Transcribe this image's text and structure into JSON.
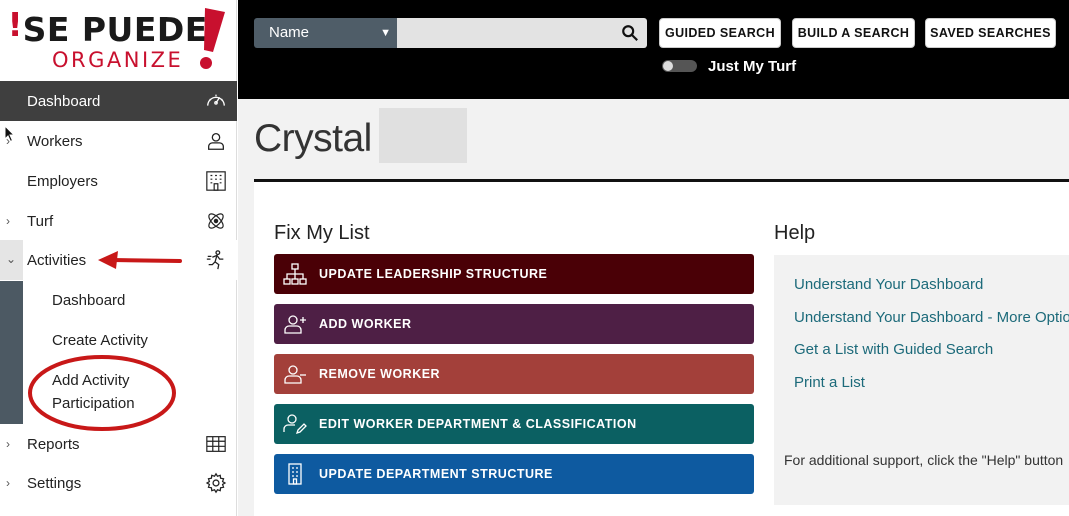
{
  "logo": {
    "line1_prefix": "¡",
    "line1_text": "SE PUEDE",
    "line2": "ORGANIZE",
    "bang": "!"
  },
  "sidebar": {
    "items": [
      {
        "label": "Dashboard",
        "icon": "speedometer-icon"
      },
      {
        "label": "Workers",
        "icon": "person-icon"
      },
      {
        "label": "Employers",
        "icon": "building-icon"
      },
      {
        "label": "Turf",
        "icon": "atom-icon"
      },
      {
        "label": "Activities",
        "icon": "activity-icon"
      },
      {
        "label": "Reports",
        "icon": "table-icon"
      },
      {
        "label": "Settings",
        "icon": "gear-icon"
      }
    ],
    "activities_sub": [
      {
        "label": "Dashboard"
      },
      {
        "label": "Create Activity"
      },
      {
        "label": "Add Activity Participation"
      }
    ]
  },
  "topbar": {
    "search_select_value": "Name",
    "search_placeholder": "",
    "buttons": [
      "GUIDED SEARCH",
      "BUILD A SEARCH",
      "SAVED SEARCHES"
    ],
    "toggle_label": "Just My Turf"
  },
  "main": {
    "title": "Crystal",
    "fix_heading": "Fix My List",
    "fix_buttons": [
      {
        "label": "UPDATE LEADERSHIP STRUCTURE",
        "color": "#4a0006",
        "icon": "org-chart-icon"
      },
      {
        "label": "ADD WORKER",
        "color": "#4e1f45",
        "icon": "add-user-icon"
      },
      {
        "label": "REMOVE WORKER",
        "color": "#a3403a",
        "icon": "remove-user-icon"
      },
      {
        "label": "EDIT WORKER DEPARTMENT & CLASSIFICATION",
        "color": "#0b6062",
        "icon": "edit-user-icon"
      },
      {
        "label": "UPDATE DEPARTMENT STRUCTURE",
        "color": "#0e5aa0",
        "icon": "building-icon"
      }
    ],
    "help_heading": "Help",
    "help_links": [
      "Understand Your Dashboard",
      "Understand Your Dashboard - More Options",
      "Get a List with Guided Search",
      "Print a List"
    ],
    "help_footer": "For additional support, click the \"Help\" button"
  },
  "colors": {
    "brand_red": "#c8102e",
    "annotation_red": "#c81818",
    "link_teal": "#1c6a7a"
  }
}
